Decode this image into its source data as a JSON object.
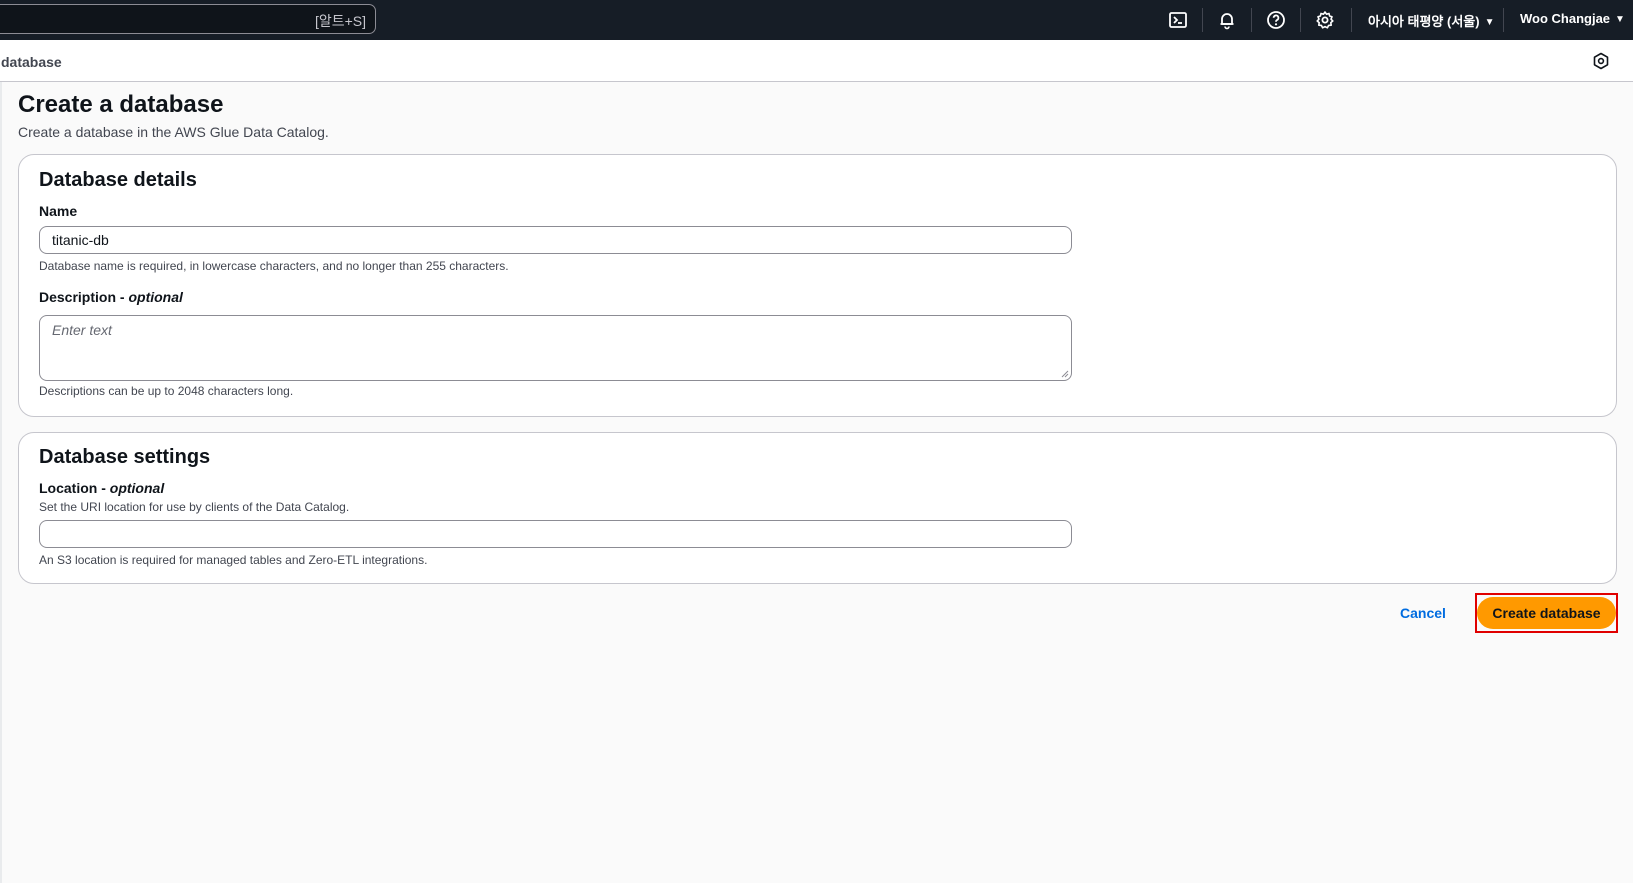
{
  "topnav": {
    "search_shortcut": "[알트+S]",
    "region": "아시아 태평양 (서울)",
    "user": "Woo Changjae",
    "icons": [
      "cloudshell-icon",
      "bell-icon",
      "help-icon",
      "gear-icon"
    ]
  },
  "breadcrumb": {
    "current": "database"
  },
  "page": {
    "title": "Create a database",
    "description": "Create a database in the AWS Glue Data Catalog."
  },
  "details": {
    "header": "Database details",
    "name_label": "Name",
    "name_value": "titanic-db",
    "name_hint": "Database name is required, in lowercase characters, and no longer than 255 characters.",
    "description_label": "Description - ",
    "description_optional": "optional",
    "description_placeholder": "Enter text",
    "description_hint": "Descriptions can be up to 2048 characters long."
  },
  "settings": {
    "header": "Database settings",
    "location_label": "Location - ",
    "location_optional": "optional",
    "location_desc": "Set the URI location for use by clients of the Data Catalog.",
    "location_value": "",
    "location_hint": "An S3 location is required for managed tables and Zero-ETL integrations."
  },
  "actions": {
    "cancel": "Cancel",
    "create": "Create database"
  },
  "colors": {
    "nav_bg": "#161d26",
    "primary_button": "#ff9900",
    "link": "#006ce0",
    "highlight": "#e00000"
  }
}
